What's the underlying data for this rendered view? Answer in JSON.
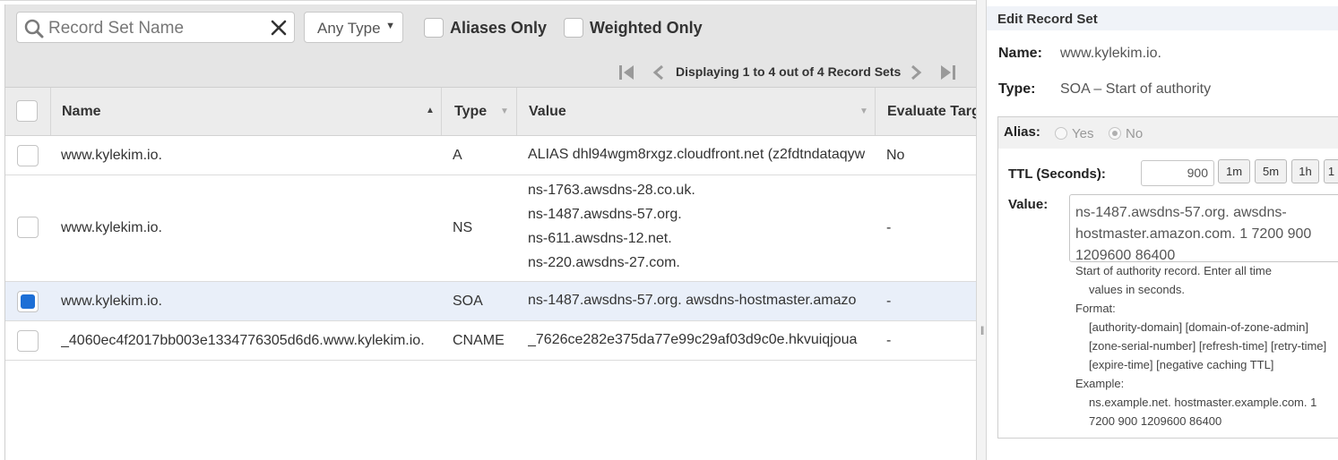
{
  "search": {
    "placeholder": "Record Set Name"
  },
  "type_filter": {
    "selected": "Any Type"
  },
  "filters": {
    "aliases_only": "Aliases Only",
    "weighted_only": "Weighted Only"
  },
  "pager": {
    "text": "Displaying 1 to 4 out of 4 Record Sets"
  },
  "table": {
    "columns": [
      "Name",
      "Type",
      "Value",
      "Evaluate Targ"
    ],
    "rows": [
      {
        "name": "www.kylekim.io.",
        "type": "A",
        "value": [
          "ALIAS dhl94wgm8rxgz.cloudfront.net (z2fdtndataqyw"
        ],
        "evaluate": "No",
        "selected": false
      },
      {
        "name": "www.kylekim.io.",
        "type": "NS",
        "value": [
          "ns-1763.awsdns-28.co.uk.",
          "ns-1487.awsdns-57.org.",
          "ns-611.awsdns-12.net.",
          "ns-220.awsdns-27.com."
        ],
        "evaluate": "-",
        "selected": false
      },
      {
        "name": "www.kylekim.io.",
        "type": "SOA",
        "value": [
          "ns-1487.awsdns-57.org. awsdns-hostmaster.amazo"
        ],
        "evaluate": "-",
        "selected": true
      },
      {
        "name": "_4060ec4f2017bb003e1334776305d6d6.www.kylekim.io.",
        "type": "CNAME",
        "value": [
          "_7626ce282e375da77e99c29af03d9c0e.hkvuiqjoua"
        ],
        "evaluate": "-",
        "selected": false
      }
    ]
  },
  "edit": {
    "title": "Edit Record Set",
    "name_label": "Name:",
    "name_value": "www.kylekim.io.",
    "type_label": "Type:",
    "type_value": "SOA – Start of authority",
    "alias_label": "Alias:",
    "alias_yes": "Yes",
    "alias_no": "No",
    "ttl_label": "TTL (Seconds):",
    "ttl_value": "900",
    "ttl_buttons": [
      "1m",
      "5m",
      "1h",
      "1"
    ],
    "value_label": "Value:",
    "value_text": "ns-1487.awsdns-57.org. awsdns-hostmaster.amazon.com. 1 7200 900 1209600 86400",
    "help": {
      "l1": "Start of authority record. Enter all time",
      "l2": "values in seconds.",
      "l3": "Format:",
      "l4": "[authority-domain] [domain-of-zone-admin]",
      "l5": "[zone-serial-number] [refresh-time] [retry-time]",
      "l6": "[expire-time] [negative caching TTL]",
      "l7": "Example:",
      "l8": "ns.example.net. hostmaster.example.com. 1",
      "l9": "7200 900 1209600 86400"
    }
  },
  "colors": {
    "selected_row": "#e9eff9",
    "checkbox_checked": "#1d6fd6",
    "toolbar": "#e5e5e5"
  }
}
